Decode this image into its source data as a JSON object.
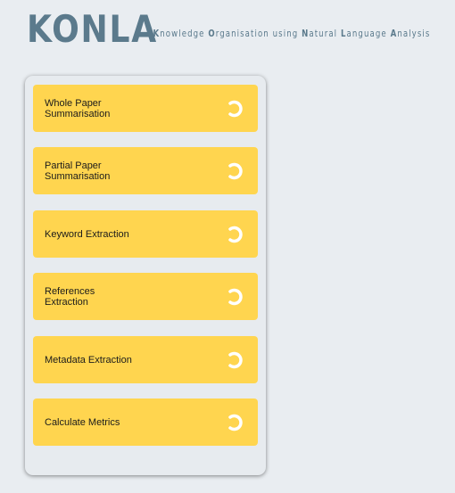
{
  "header": {
    "logo": "KONLA",
    "tagline_prefix": "— ",
    "tagline_parts": [
      {
        "initial": "K",
        "rest": "nowledge "
      },
      {
        "initial": "O",
        "rest": "rganisation using "
      },
      {
        "initial": "N",
        "rest": "atural "
      },
      {
        "initial": "L",
        "rest": "anguage "
      },
      {
        "initial": "A",
        "rest": "nalysis"
      }
    ]
  },
  "tools": [
    {
      "label": "Whole Paper Summarisation",
      "icon": "spinner-icon"
    },
    {
      "label": "Partial Paper Summarisation",
      "icon": "spinner-icon"
    },
    {
      "label": "Keyword Extraction",
      "icon": "spinner-icon"
    },
    {
      "label": "References Extraction",
      "icon": "spinner-icon"
    },
    {
      "label": "Metadata Extraction",
      "icon": "spinner-icon"
    },
    {
      "label": "Calculate Metrics",
      "icon": "spinner-icon"
    }
  ],
  "colors": {
    "background": "#e9edf1",
    "brand": "#5b7a8c",
    "button": "#ffd54f",
    "spinner": "#ffffff"
  }
}
